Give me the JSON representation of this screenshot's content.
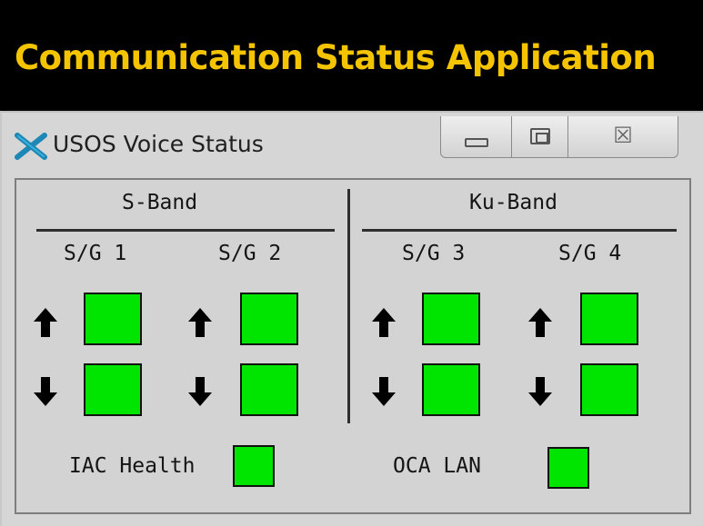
{
  "banner": {
    "title": "Communication Status Application"
  },
  "window": {
    "title": "USOS Voice Status",
    "icons": {
      "app": "x-logo-icon",
      "minimize": "minimize-icon",
      "maximize": "maximize-icon",
      "close": "close-icon"
    },
    "close_glyph": "☒"
  },
  "bands": [
    {
      "name": "S-Band",
      "groups": [
        {
          "label": "S/G 1",
          "uplink": "ok",
          "downlink": "ok"
        },
        {
          "label": "S/G 2",
          "uplink": "ok",
          "downlink": "ok"
        }
      ]
    },
    {
      "name": "Ku-Band",
      "groups": [
        {
          "label": "S/G 3",
          "uplink": "ok",
          "downlink": "ok"
        },
        {
          "label": "S/G 4",
          "uplink": "ok",
          "downlink": "ok"
        }
      ]
    }
  ],
  "footer": {
    "iac_health_label": "IAC Health",
    "oca_lan_label": "OCA LAN",
    "iac_health_status": "ok",
    "oca_lan_status": "ok"
  },
  "colors": {
    "banner_text": "#f5c400",
    "status_ok": "#00e500",
    "window_bg": "#d6d6d6"
  }
}
